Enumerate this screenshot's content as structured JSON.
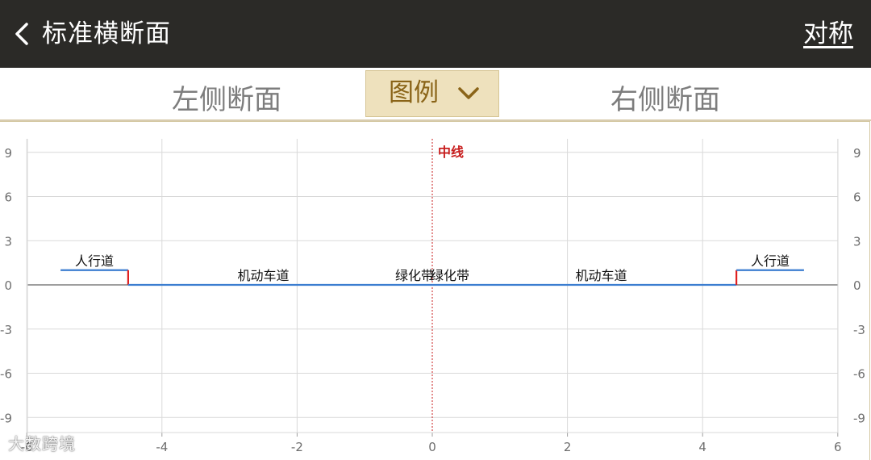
{
  "header": {
    "title": "标准横断面",
    "symmetric_label": "对称",
    "bg_color": "#2b2a27"
  },
  "tabs": {
    "left_label": "左侧断面",
    "right_label": "右侧断面",
    "legend_label": "图例",
    "legend_bg_color": "#eee1bd",
    "legend_text_color": "#8a6418"
  },
  "watermark": "大数跨境",
  "chart_data": {
    "type": "line",
    "xlim": [
      -6,
      6
    ],
    "ylim": [
      -10,
      10
    ],
    "x_ticks": [
      -6,
      -4,
      -2,
      0,
      2,
      4,
      6
    ],
    "y_ticks": [
      9,
      6,
      3,
      0,
      -3,
      -6,
      -9
    ],
    "grid": true,
    "centerline_label": "中线",
    "colors": {
      "profile": "#3b7dd0",
      "curb": "#e02020",
      "centerline": "#c81e1e",
      "grid": "#d9d9d9",
      "axis": "#9e9e9e",
      "tick_text": "#6e6e6e"
    },
    "profile": [
      {
        "x": -5.5,
        "y": 1
      },
      {
        "x": -4.5,
        "y": 1
      },
      {
        "x": -4.5,
        "y": 0
      },
      {
        "x": 4.5,
        "y": 0
      },
      {
        "x": 4.5,
        "y": 1
      },
      {
        "x": 5.5,
        "y": 1
      }
    ],
    "curbs": [
      {
        "x": -4.5,
        "y0": 0,
        "y1": 1
      },
      {
        "x": 4.5,
        "y0": 0,
        "y1": 1
      }
    ],
    "segment_labels": [
      {
        "text": "人行道",
        "x": -5.0,
        "y": 1
      },
      {
        "text": "机动车道",
        "x": -2.5,
        "y": 0
      },
      {
        "text": "绿化带",
        "x": -0.25,
        "y": 0
      },
      {
        "text": "绿化带",
        "x": 0.25,
        "y": 0
      },
      {
        "text": "机动车道",
        "x": 2.5,
        "y": 0
      },
      {
        "text": "人行道",
        "x": 5.0,
        "y": 1
      }
    ]
  }
}
